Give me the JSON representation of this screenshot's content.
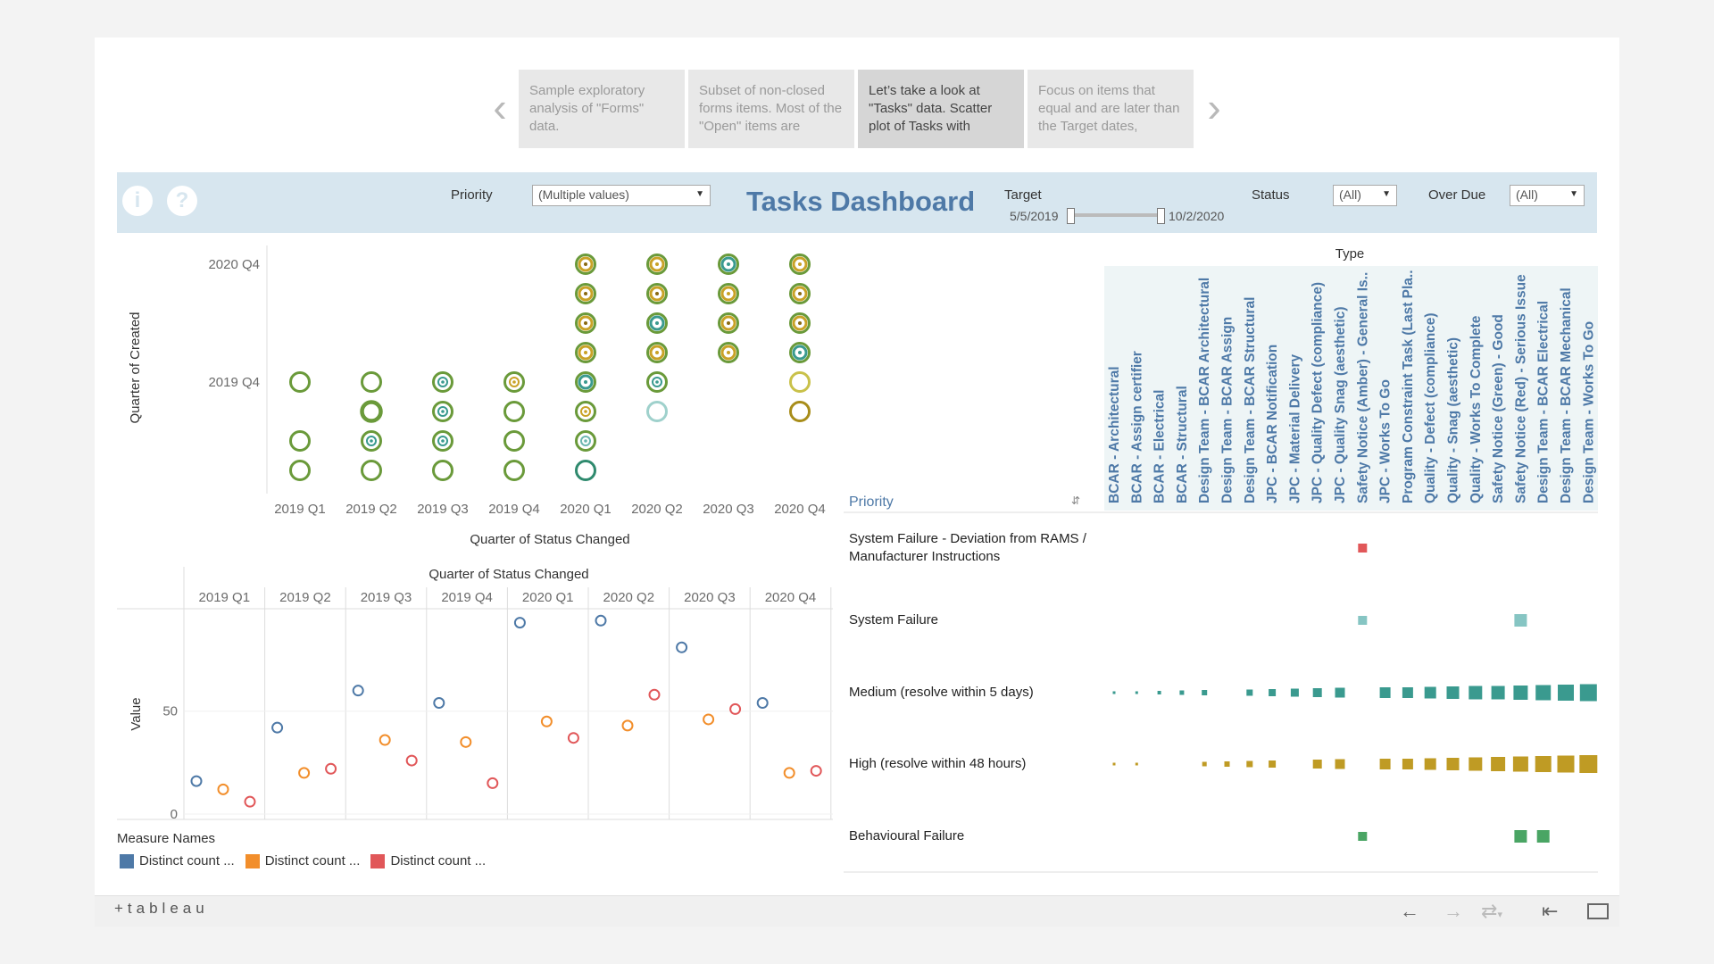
{
  "story": {
    "points": [
      "Sample exploratory analysis of \"Forms\" data.",
      "Subset of non-closed forms items. Most of the \"Open\" items are",
      "Let’s take a look at \"Tasks\" data. Scatter plot of Tasks with",
      "Focus on items that equal and are later than the Target dates,"
    ],
    "active_index": 2,
    "prev_icon": "chevron-left-icon",
    "next_icon": "chevron-right-icon"
  },
  "header": {
    "info_icon": "i",
    "help_icon": "?",
    "priority_label": "Priority",
    "priority_value": "(Multiple values)",
    "title": "Tasks Dashboard",
    "target_label": "Target",
    "target_start": "5/5/2019",
    "target_end": "10/2/2020",
    "status_label": "Status",
    "status_value": "(All)",
    "overdue_label": "Over Due",
    "overdue_value": "(All)",
    "bg_color": "#d7e6ef",
    "title_color": "#4e79a7"
  },
  "chart_data": [
    {
      "type": "scatter",
      "xlabel": "Quarter of Status Changed",
      "ylabel": "Quarter of Created",
      "x_categories": [
        "2019 Q1",
        "2019 Q2",
        "2019 Q3",
        "2019 Q4",
        "2020 Q1",
        "2020 Q2",
        "2020 Q3",
        "2020 Q4"
      ],
      "y_tick_labels": [
        "2020 Q4",
        "2019 Q4"
      ],
      "y_rows": [
        "2020 Q4",
        "2020 Q3",
        "2020 Q2",
        "2020 Q1",
        "2019 Q4",
        "2019 Q3",
        "2019 Q2",
        "2019 Q1"
      ],
      "points": [
        {
          "x": "2019 Q1",
          "y": "2019 Q4",
          "style": "ring"
        },
        {
          "x": "2019 Q1",
          "y": "2019 Q2",
          "style": "ring"
        },
        {
          "x": "2019 Q1",
          "y": "2019 Q1",
          "style": "ring"
        },
        {
          "x": "2019 Q2",
          "y": "2019 Q4",
          "style": "ring"
        },
        {
          "x": "2019 Q2",
          "y": "2019 Q3",
          "style": "ring-thick"
        },
        {
          "x": "2019 Q2",
          "y": "2019 Q2",
          "style": "ring-dot-teal"
        },
        {
          "x": "2019 Q2",
          "y": "2019 Q1",
          "style": "ring"
        },
        {
          "x": "2019 Q3",
          "y": "2019 Q4",
          "style": "ring-dot-teal"
        },
        {
          "x": "2019 Q3",
          "y": "2019 Q3",
          "style": "ring-dot-teal"
        },
        {
          "x": "2019 Q3",
          "y": "2019 Q2",
          "style": "ring-dot-teal"
        },
        {
          "x": "2019 Q3",
          "y": "2019 Q1",
          "style": "ring"
        },
        {
          "x": "2019 Q4",
          "y": "2019 Q4",
          "style": "ring-dot-gold"
        },
        {
          "x": "2019 Q4",
          "y": "2019 Q3",
          "style": "ring"
        },
        {
          "x": "2019 Q4",
          "y": "2019 Q2",
          "style": "ring"
        },
        {
          "x": "2019 Q4",
          "y": "2019 Q1",
          "style": "ring"
        },
        {
          "x": "2020 Q1",
          "y": "2020 Q4",
          "style": "multi"
        },
        {
          "x": "2020 Q1",
          "y": "2020 Q3",
          "style": "multi"
        },
        {
          "x": "2020 Q1",
          "y": "2020 Q2",
          "style": "multi"
        },
        {
          "x": "2020 Q1",
          "y": "2020 Q1",
          "style": "multi-gold"
        },
        {
          "x": "2020 Q1",
          "y": "2019 Q4",
          "style": "multi-teal"
        },
        {
          "x": "2020 Q1",
          "y": "2019 Q3",
          "style": "ring-dot-gold"
        },
        {
          "x": "2020 Q1",
          "y": "2019 Q2",
          "style": "ring-dot-teal-light"
        },
        {
          "x": "2020 Q1",
          "y": "2019 Q1",
          "style": "ring-teal"
        },
        {
          "x": "2020 Q2",
          "y": "2020 Q4",
          "style": "multi-gold"
        },
        {
          "x": "2020 Q2",
          "y": "2020 Q3",
          "style": "multi"
        },
        {
          "x": "2020 Q2",
          "y": "2020 Q2",
          "style": "multi-teal"
        },
        {
          "x": "2020 Q2",
          "y": "2020 Q1",
          "style": "multi-gold"
        },
        {
          "x": "2020 Q2",
          "y": "2019 Q4",
          "style": "ring-dot-teal"
        },
        {
          "x": "2020 Q2",
          "y": "2019 Q3",
          "style": "ring-light"
        },
        {
          "x": "2020 Q3",
          "y": "2020 Q4",
          "style": "multi-teal"
        },
        {
          "x": "2020 Q3",
          "y": "2020 Q3",
          "style": "multi-gold"
        },
        {
          "x": "2020 Q3",
          "y": "2020 Q2",
          "style": "multi"
        },
        {
          "x": "2020 Q3",
          "y": "2020 Q1",
          "style": "multi-gold"
        },
        {
          "x": "2020 Q4",
          "y": "2020 Q4",
          "style": "multi-gold"
        },
        {
          "x": "2020 Q4",
          "y": "2020 Q3",
          "style": "multi"
        },
        {
          "x": "2020 Q4",
          "y": "2020 Q2",
          "style": "multi"
        },
        {
          "x": "2020 Q4",
          "y": "2020 Q1",
          "style": "multi-teal"
        },
        {
          "x": "2020 Q4",
          "y": "2019 Q4",
          "style": "ring-gold"
        },
        {
          "x": "2020 Q4",
          "y": "2019 Q3",
          "style": "ring-gold-dark"
        }
      ]
    },
    {
      "type": "scatter",
      "title": "Quarter of Status Changed",
      "ylabel": "Value",
      "ylim": [
        0,
        95
      ],
      "y_ticks": [
        0,
        50
      ],
      "categories": [
        "2019 Q1",
        "2019 Q2",
        "2019 Q3",
        "2019 Q4",
        "2020 Q1",
        "2020 Q2",
        "2020 Q3",
        "2020 Q4"
      ],
      "series": [
        {
          "name": "Distinct count ...",
          "color": "#4e79a7",
          "values": [
            16,
            42,
            60,
            54,
            93,
            94,
            81,
            54
          ]
        },
        {
          "name": "Distinct count ...",
          "color": "#f28e2b",
          "values": [
            12,
            20,
            36,
            35,
            45,
            43,
            46,
            20
          ]
        },
        {
          "name": "Distinct count ...",
          "color": "#e15759",
          "values": [
            6,
            22,
            26,
            15,
            37,
            58,
            51,
            21
          ]
        }
      ],
      "legend_title": "Measure Names",
      "legend_position": "bottom-left"
    },
    {
      "type": "heatmap",
      "title": "Type",
      "row_header": "Priority",
      "columns": [
        "BCAR - Architectural",
        "BCAR - Assign certifier",
        "BCAR - Electrical",
        "BCAR - Structural",
        "Design Team - BCAR Architectural",
        "Design Team - BCAR Assign",
        "Design Team - BCAR Structural",
        "JPC - BCAR Notification",
        "JPC - Material Delivery",
        "JPC - Quality Defect (compliance)",
        "JPC - Quality Snag (aesthetic)",
        "Safety Notice (Amber) - General Is..",
        "JPC - Works To Go",
        "Program Constraint Task (Last Pla..",
        "Quality - Defect (compliance)",
        "Quality - Snag (aesthetic)",
        "Quality - Works To Complete",
        "Safety Notice (Green) - Good",
        "Safety Notice (Red) - Serious Issue",
        "Design Team - BCAR Electrical",
        "Design Team - BCAR Mechanical",
        "Design Team - Works To Go"
      ],
      "rows": [
        {
          "label": "System Failure - Deviation from RAMS / Manufacturer Instructions",
          "color": "#e15759",
          "sizes": [
            0,
            0,
            0,
            0,
            0,
            0,
            0,
            0,
            0,
            0,
            0,
            10,
            0,
            0,
            0,
            0,
            0,
            0,
            0,
            0,
            0,
            0
          ]
        },
        {
          "label": "System Failure",
          "color": "#86c5c3",
          "sizes": [
            0,
            0,
            0,
            0,
            0,
            0,
            0,
            0,
            0,
            0,
            0,
            10,
            0,
            0,
            0,
            0,
            0,
            0,
            14,
            0,
            0,
            0
          ]
        },
        {
          "label": "Medium (resolve within 5 days)",
          "color": "#3a9a8f",
          "sizes": [
            3,
            3,
            4,
            5,
            6,
            0,
            7,
            8,
            9,
            10,
            11,
            0,
            12,
            12,
            13,
            14,
            15,
            15,
            16,
            17,
            18,
            19
          ]
        },
        {
          "label": "High (resolve within 48 hours)",
          "color": "#bf9b24",
          "sizes": [
            3,
            3,
            0,
            0,
            5,
            6,
            7,
            8,
            0,
            10,
            11,
            0,
            12,
            12,
            13,
            14,
            15,
            16,
            17,
            18,
            19,
            20
          ]
        },
        {
          "label": "Behavioural Failure",
          "color": "#4aa564",
          "sizes": [
            0,
            0,
            0,
            0,
            0,
            0,
            0,
            0,
            0,
            0,
            0,
            10,
            0,
            0,
            0,
            0,
            0,
            0,
            14,
            14,
            0,
            0
          ]
        }
      ]
    }
  ],
  "footer": {
    "logo": "+tableau",
    "undo_icon": "arrow-left-icon",
    "redo_icon": "arrow-right-icon",
    "revert_icon": "revert-icon",
    "reset_icon": "reset-icon",
    "fullscreen_icon": "fullscreen-icon"
  }
}
